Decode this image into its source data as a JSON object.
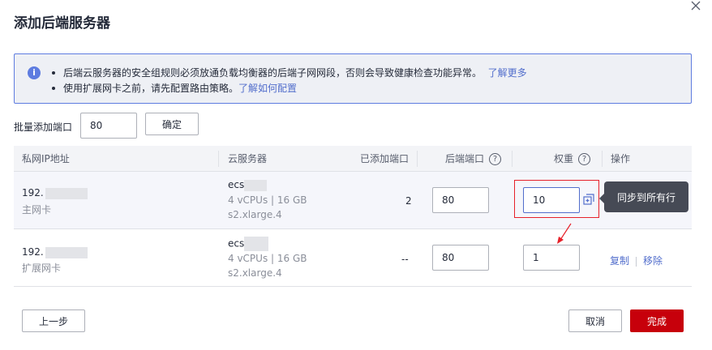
{
  "dialog": {
    "title": "添加后端服务器"
  },
  "notice": {
    "line1_text": "后端云服务器的安全组规则必须放通负载均衡器的后端子网网段，否则会导致健康检查功能异常。",
    "line1_link": "了解更多",
    "line2_text": "使用扩展网卡之前，请先配置路由策略。",
    "line2_link": "了解如何配置"
  },
  "batch": {
    "label": "批量添加端口",
    "value": "80",
    "confirm_label": "确定"
  },
  "table": {
    "headers": {
      "private_ip": "私网IP地址",
      "server": "云服务器",
      "added_ports": "已添加端口",
      "backend_port": "后端端口",
      "weight": "权重",
      "actions": "操作"
    },
    "rows": [
      {
        "ip_prefix": "192.",
        "nic_type": "主网卡",
        "server_prefix": "ecs",
        "spec": "4 vCPUs | 16 GB",
        "flavor": "s2.xlarge.4",
        "added_ports": "2",
        "backend_port": "80",
        "weight": "10"
      },
      {
        "ip_prefix": "192.",
        "nic_type": "扩展网卡",
        "server_prefix": "ecs",
        "spec": "4 vCPUs | 16 GB",
        "flavor": "s2.xlarge.4",
        "added_ports": "--",
        "backend_port": "80",
        "weight": "1",
        "copy_label": "复制",
        "remove_label": "移除"
      }
    ],
    "tooltip": "同步到所有行"
  },
  "footer": {
    "prev_label": "上一步",
    "cancel_label": "取消",
    "done_label": "完成"
  },
  "colors": {
    "primary_red": "#c7000b",
    "link_blue": "#526ecc",
    "notice_border": "#5e7ce0",
    "highlight_red": "#e6212a"
  },
  "icons": {
    "close": "close-icon",
    "info": "info-icon",
    "help": "help-circle-icon",
    "sync": "sync-rows-icon"
  }
}
